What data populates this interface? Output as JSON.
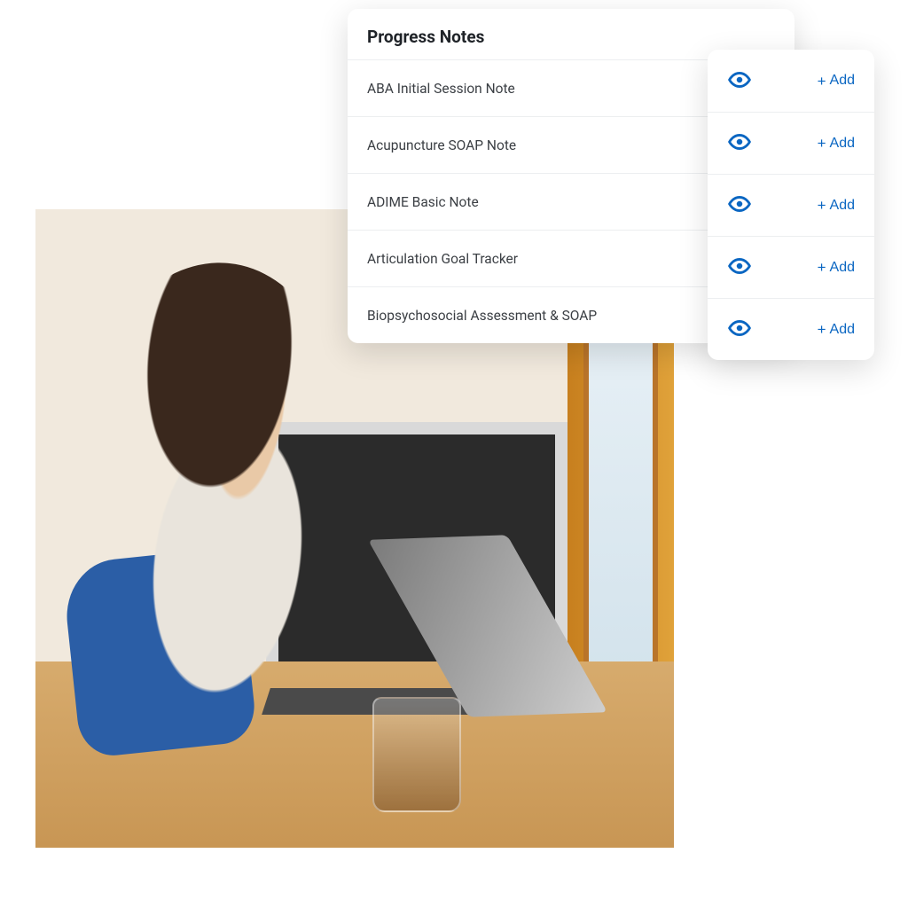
{
  "colors": {
    "accent": "#0a66c2",
    "text": "#3b3f44",
    "heading": "#1f2328",
    "divider": "#eceef0"
  },
  "notes_panel": {
    "title": "Progress Notes",
    "items": [
      {
        "label": "ABA Initial Session Note"
      },
      {
        "label": "Acupuncture SOAP Note"
      },
      {
        "label": "ADIME Basic Note"
      },
      {
        "label": "Articulation Goal Tracker"
      },
      {
        "label": "Biopsychosocial Assessment & SOAP"
      }
    ]
  },
  "actions_panel": {
    "add_label": "Add",
    "plus_glyph": "+",
    "rows": 5
  }
}
